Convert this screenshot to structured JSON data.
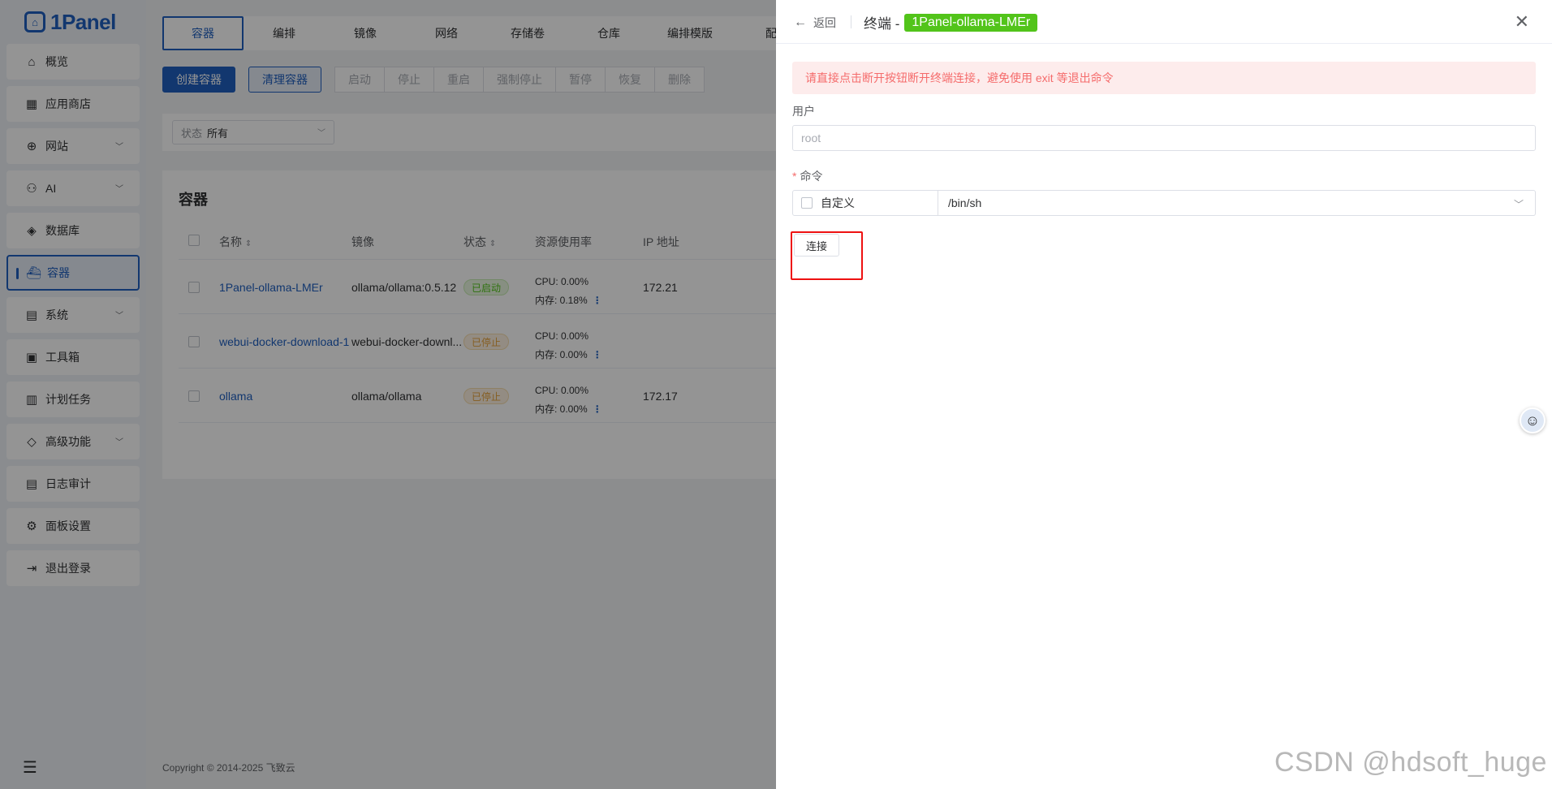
{
  "app": {
    "logo": "1Panel"
  },
  "sidebar": {
    "items": [
      {
        "label": "概览",
        "icon": "home-icon",
        "expandable": false
      },
      {
        "label": "应用商店",
        "icon": "grid-icon",
        "expandable": false
      },
      {
        "label": "网站",
        "icon": "globe-icon",
        "expandable": true
      },
      {
        "label": "AI",
        "icon": "robot-icon",
        "expandable": true
      },
      {
        "label": "数据库",
        "icon": "layers-icon",
        "expandable": false
      },
      {
        "label": "容器",
        "icon": "docker-icon",
        "expandable": false,
        "active": true
      },
      {
        "label": "系统",
        "icon": "server-icon",
        "expandable": true
      },
      {
        "label": "工具箱",
        "icon": "toolbox-icon",
        "expandable": false
      },
      {
        "label": "计划任务",
        "icon": "calendar-icon",
        "expandable": false
      },
      {
        "label": "高级功能",
        "icon": "diamond-icon",
        "expandable": true
      },
      {
        "label": "日志审计",
        "icon": "document-icon",
        "expandable": false
      },
      {
        "label": "面板设置",
        "icon": "gear-icon",
        "expandable": false
      },
      {
        "label": "退出登录",
        "icon": "logout-icon",
        "expandable": false
      }
    ]
  },
  "tabs": [
    "容器",
    "编排",
    "镜像",
    "网络",
    "存储卷",
    "仓库",
    "编排模版",
    "配"
  ],
  "toolbar": {
    "create": "创建容器",
    "clean": "清理容器",
    "actions": [
      "启动",
      "停止",
      "重启",
      "强制停止",
      "暂停",
      "恢复",
      "删除"
    ]
  },
  "filter": {
    "label": "状态",
    "value": "所有"
  },
  "table": {
    "title": "容器",
    "headers": {
      "name": "名称",
      "image": "镜像",
      "status": "状态",
      "resource": "资源使用率",
      "ip": "IP 地址"
    },
    "rows": [
      {
        "name": "1Panel-ollama-LMEr",
        "image": "ollama/ollama:0.5.12",
        "status": "已启动",
        "status_kind": "ok",
        "cpu": "CPU: 0.00%",
        "mem": "内存: 0.18%",
        "ip": "172.21"
      },
      {
        "name": "webui-docker-download-1",
        "image": "webui-docker-downl...",
        "status": "已停止",
        "status_kind": "stop",
        "cpu": "CPU: 0.00%",
        "mem": "内存: 0.00%",
        "ip": ""
      },
      {
        "name": "ollama",
        "image": "ollama/ollama",
        "status": "已停止",
        "status_kind": "stop",
        "cpu": "CPU: 0.00%",
        "mem": "内存: 0.00%",
        "ip": "172.17"
      }
    ]
  },
  "footer": "Copyright © 2014-2025 飞致云",
  "drawer": {
    "back": "返回",
    "title_prefix": "终端 -",
    "container_tag": "1Panel-ollama-LMEr",
    "alert": "请直接点击断开按钮断开终端连接，避免使用 exit 等退出命令",
    "user_label": "用户",
    "user_placeholder": "root",
    "command_label": "命令",
    "custom_label": "自定义",
    "command_value": "/bin/sh",
    "connect_button": "连接"
  },
  "watermark": "CSDN @hdsoft_huge",
  "colors": {
    "brand": "#1f5fbf",
    "success": "#52c41a",
    "warning": "#e6a23c",
    "danger": "#f56c6c",
    "highlight": "#ee1111"
  }
}
